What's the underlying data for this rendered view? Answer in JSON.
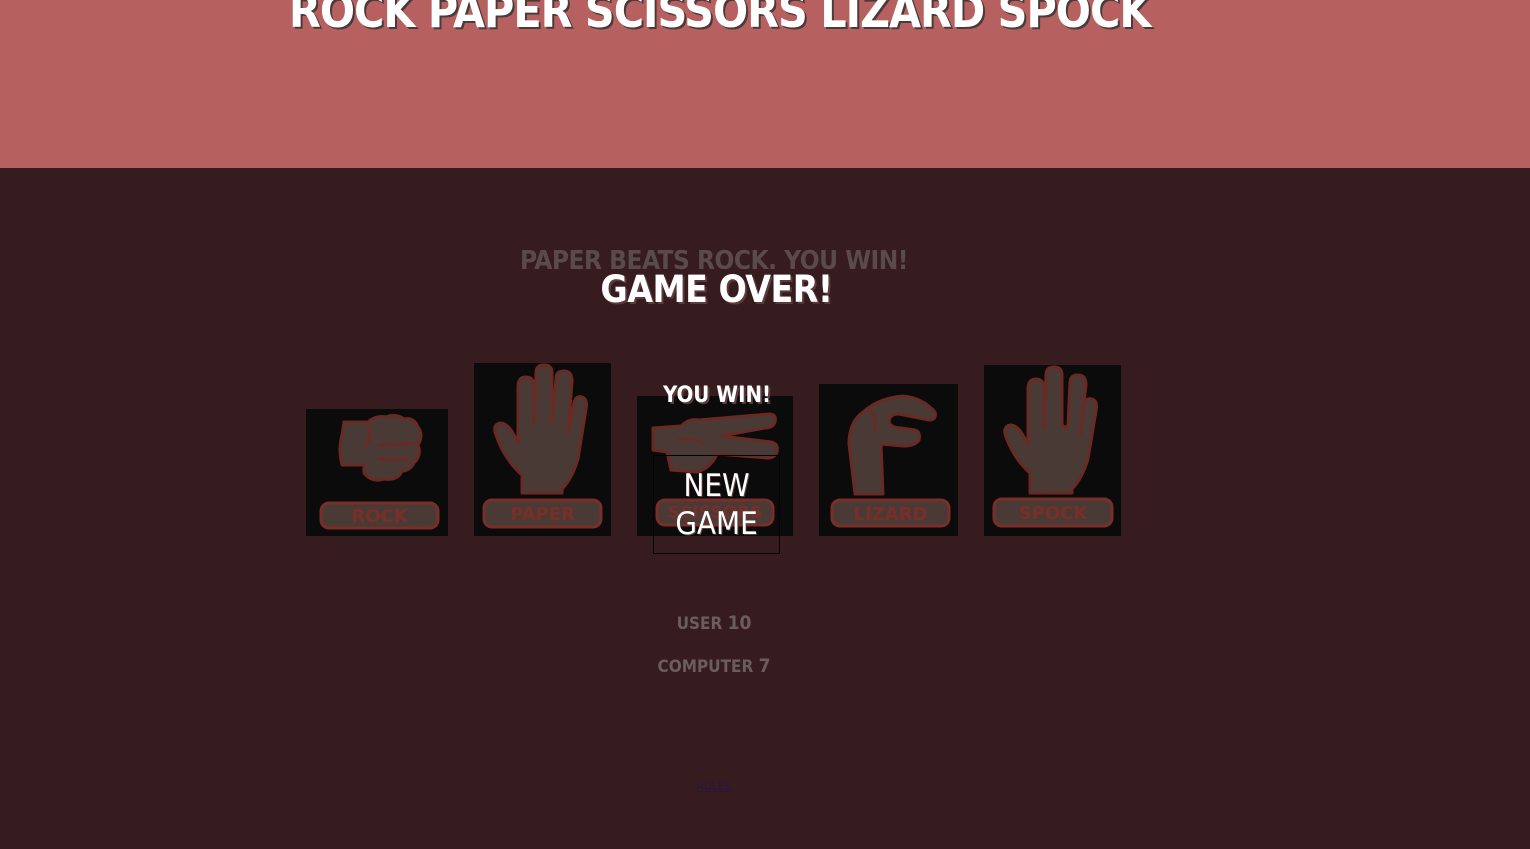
{
  "header": {
    "title": "ROCK PAPER SCISSORS LIZARD SPOCK"
  },
  "round": {
    "result": "PAPER BEATS ROCK. YOU WIN!"
  },
  "choices": [
    {
      "label": "ROCK",
      "icon": "fist-icon"
    },
    {
      "label": "PAPER",
      "icon": "open-hand-icon"
    },
    {
      "label": "SCISSORS",
      "icon": "scissors-hand-icon"
    },
    {
      "label": "LIZARD",
      "icon": "lizard-hand-icon"
    },
    {
      "label": "SPOCK",
      "icon": "vulcan-salute-icon"
    }
  ],
  "scores": {
    "user_label": "USER",
    "user_value": "10",
    "computer_label": "COMPUTER",
    "computer_value": "7"
  },
  "footer": {
    "rules_label": "RULES"
  },
  "modal": {
    "title": "GAME OVER!",
    "message": "YOU WIN!",
    "new_game_label": "NEW GAME"
  },
  "colors": {
    "header_bg": "#b76060",
    "page_bg": "#371c1f",
    "hand_fill": "#4a3a36",
    "hand_stroke": "#6a2a24",
    "badge_fill": "#4a3a36",
    "badge_stroke": "#7a2e28",
    "badge_text": "#7a2e28"
  }
}
